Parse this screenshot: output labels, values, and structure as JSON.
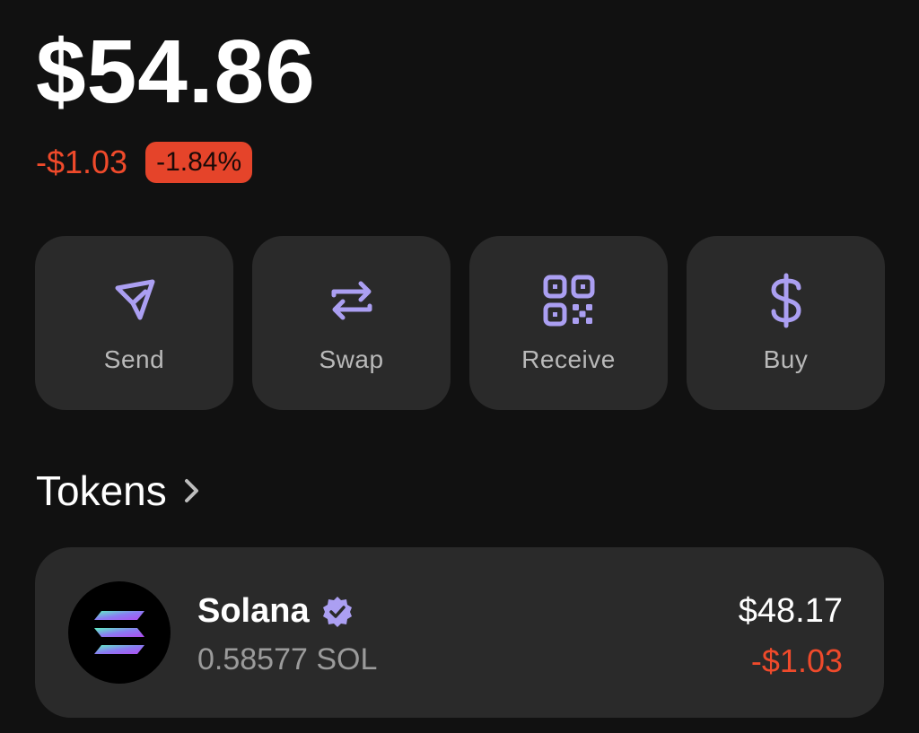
{
  "portfolio": {
    "balance": "$54.86",
    "change_amount": "-$1.03",
    "change_percent": "-1.84%"
  },
  "actions": [
    {
      "label": "Send",
      "icon": "send-icon"
    },
    {
      "label": "Swap",
      "icon": "swap-icon"
    },
    {
      "label": "Receive",
      "icon": "qr-code-icon"
    },
    {
      "label": "Buy",
      "icon": "dollar-icon"
    }
  ],
  "tokens_section": {
    "title": "Tokens"
  },
  "tokens": [
    {
      "name": "Solana",
      "amount": "0.58577 SOL",
      "value": "$48.17",
      "change": "-$1.03",
      "verified": true
    }
  ],
  "colors": {
    "background": "#111111",
    "card": "#2a2a2a",
    "accent": "#ab9ff2",
    "negative": "#ef4a2b"
  }
}
